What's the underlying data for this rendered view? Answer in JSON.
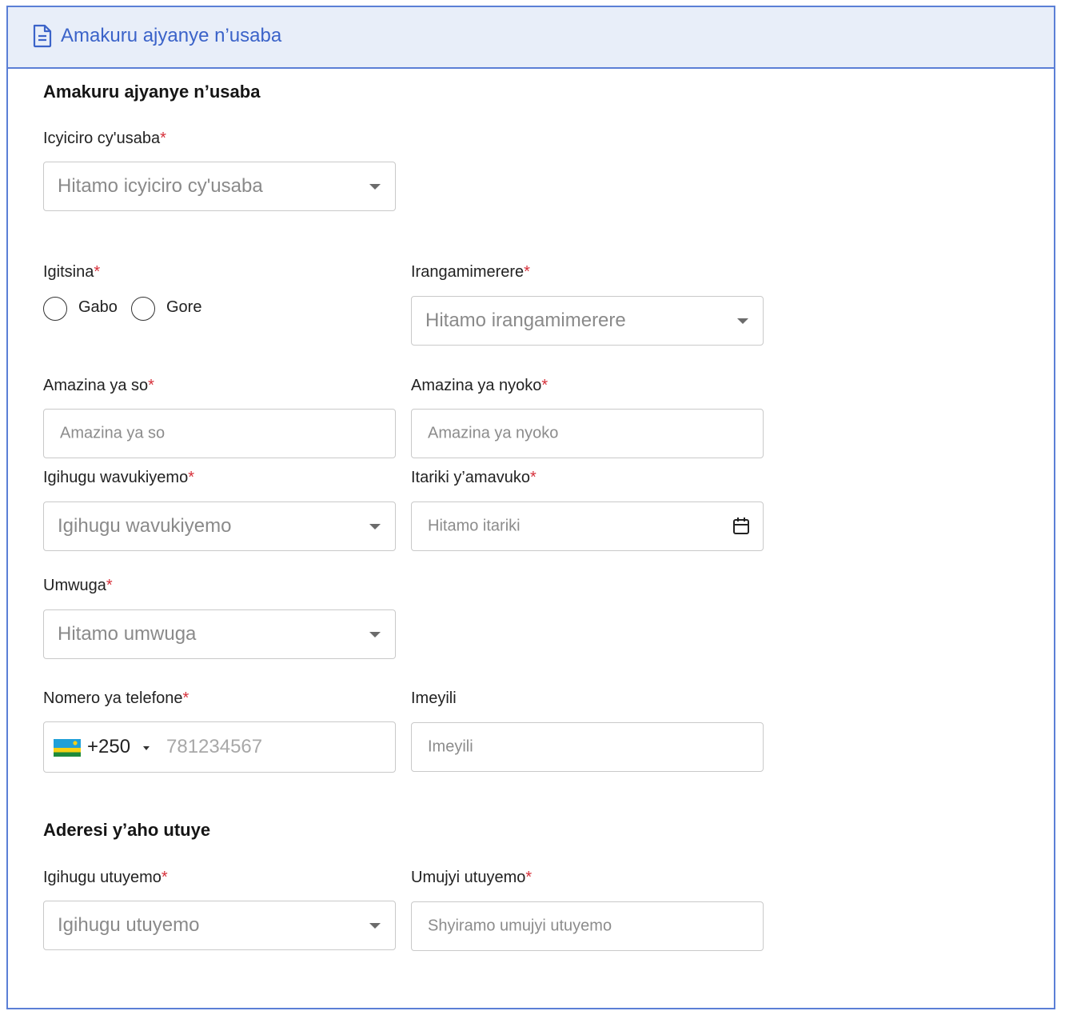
{
  "header": {
    "title": "Amakuru ajyanye n’usaba",
    "icon": "document-icon"
  },
  "section1": {
    "title": "Amakuru ajyanye n’usaba"
  },
  "applicant_category": {
    "label": "Icyiciro cy'usaba",
    "required": "*",
    "placeholder": "Hitamo icyiciro cy'usaba"
  },
  "gender": {
    "label": "Igitsina",
    "required": "*",
    "options": [
      "Gabo",
      "Gore"
    ]
  },
  "marital_status": {
    "label": "Irangamimerere",
    "required": "*",
    "placeholder": "Hitamo irangamimerere"
  },
  "father_name": {
    "label": "Amazina ya so",
    "required": "*",
    "placeholder": "Amazina ya so"
  },
  "mother_name": {
    "label": "Amazina ya nyoko",
    "required": "*",
    "placeholder": "Amazina ya nyoko"
  },
  "birth_country": {
    "label": "Igihugu wavukiyemo",
    "required": "*",
    "placeholder": "Igihugu wavukiyemo"
  },
  "birth_date": {
    "label": "Itariki y’amavuko",
    "required": "*",
    "placeholder": "Hitamo itariki",
    "icon": "calendar-icon"
  },
  "occupation": {
    "label": "Umwuga",
    "required": "*",
    "placeholder": "Hitamo umwuga"
  },
  "phone": {
    "label": "Nomero ya telefone",
    "required": "*",
    "country_code": "+250",
    "placeholder": "781234567",
    "flag": "rwanda-flag-icon"
  },
  "email": {
    "label": "Imeyili",
    "placeholder": "Imeyili"
  },
  "section2": {
    "title": "Aderesi y’aho utuye"
  },
  "residence_country": {
    "label": "Igihugu utuyemo",
    "required": "*",
    "placeholder": "Igihugu utuyemo"
  },
  "residence_city": {
    "label": "Umujyi utuyemo",
    "required": "*",
    "placeholder": "Shyiramo umujyi utuyemo"
  },
  "colors": {
    "accent": "#3b63c9",
    "border": "#5b7fd6",
    "header_bg": "#e8eef9",
    "required": "#d6303a"
  }
}
